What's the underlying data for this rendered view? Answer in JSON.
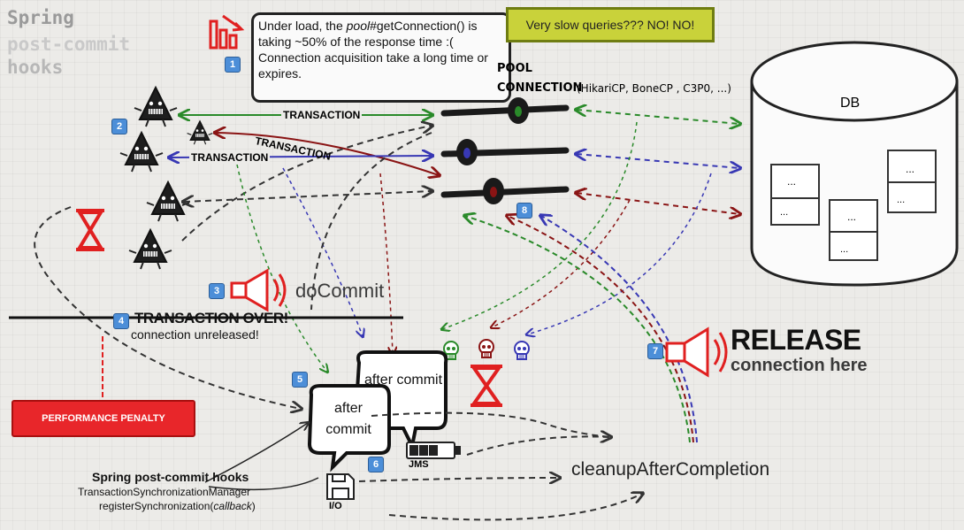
{
  "title": {
    "line1": "Spring",
    "line2": "post-commit",
    "line3": "hooks"
  },
  "callout": {
    "prefix": "Under load, the ",
    "italic": "pool",
    "rest": "#getConnection() is taking ~50% of the response time :( Connection acquisition take a long time or expires.",
    "badge": "1"
  },
  "note": "Very slow queries??? NO! NO!",
  "pool": {
    "heading": "POOL",
    "subheading": "CONNECTION",
    "detail": "(HikariCP, BoneCP , C3P0, ...)",
    "badge": "8"
  },
  "db": {
    "label": "DB",
    "table_cell": "..."
  },
  "transactions": {
    "label1": "TRANSACTION",
    "label2": "TRANSACTION",
    "label3": "TRANSACTION",
    "badge": "2"
  },
  "docommit": {
    "label": "doCommit",
    "badge": "3"
  },
  "transaction_over": {
    "title": "TRANSACTION OVER!",
    "subtitle": "connection unreleased!",
    "badge": "4"
  },
  "penalty": "PERFORMANCE PENALTY",
  "after_commit": {
    "bubble1": "after commit",
    "bubble2": "after commit",
    "badge": "5"
  },
  "jms": {
    "label": "JMS",
    "badge": "6"
  },
  "io": {
    "label": "I/O"
  },
  "release": {
    "title": "RELEASE",
    "subtitle": "connection here",
    "badge": "7"
  },
  "cleanup": "cleanupAfterCompletion",
  "hooks": {
    "title": "Spring post-commit hooks",
    "line1": "TransactionSynchronizationManager",
    "line2_pre": "registerSynchronization(",
    "line2_italic": "callback",
    "line2_post": ")"
  },
  "colors": {
    "green": "#2a8a2a",
    "darkred": "#8a1414",
    "blue": "#3838b4",
    "red": "#e02020",
    "dark": "#222222",
    "grey": "#8a8a8a"
  },
  "icons": [
    "bar-chart-icon",
    "skull-icon",
    "hourglass-icon",
    "megaphone-icon",
    "floppy-disk-icon",
    "battery-icon",
    "triangle-thread-icon"
  ]
}
